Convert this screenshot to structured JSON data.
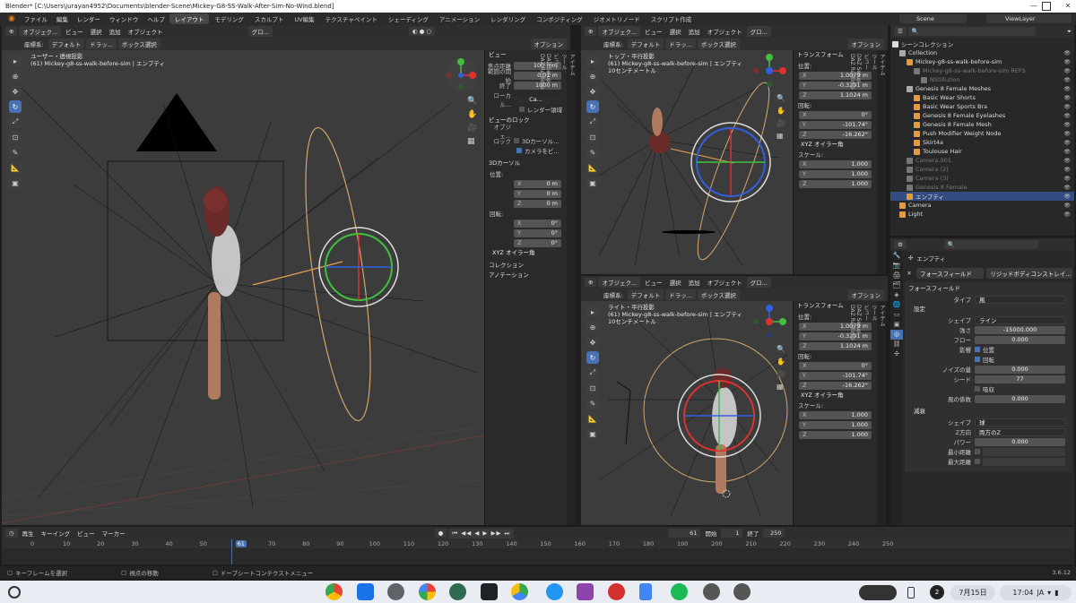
{
  "window": {
    "title": "Blender* [C:\\Users\\jurayan4952\\Documents\\blender-Scene\\Mickey-G8-SS-Walk-After-Sim-No-Wind.blend]"
  },
  "menubar": {
    "menus": [
      "ファイル",
      "編集",
      "レンダー",
      "ウィンドウ",
      "ヘルプ"
    ],
    "workspaces": [
      "レイアウト",
      "モデリング",
      "スカルプト",
      "UV編集",
      "テクスチャペイント",
      "シェーディング",
      "アニメーション",
      "レンダリング",
      "コンポジティング",
      "ジオメトリノード",
      "スクリプト作成"
    ],
    "active_workspace": "レイアウト",
    "scene": "Scene",
    "view_layer": "ViewLayer"
  },
  "viewport_main": {
    "mode": "オブジェク...",
    "menu": [
      "ビュー",
      "選択",
      "追加",
      "オブジェクト"
    ],
    "transform": "グロ...",
    "coord_label": "座標系:",
    "coord_value": "デフォルト",
    "drag": "ドラッ...",
    "select": "ボックス選択",
    "options": "オプション",
    "view_name": "ユーザー・透視投影",
    "object_info": "(61) Mickey-g8-ss-walk-before-sim | エンプティ"
  },
  "view_panel": {
    "title": "ビュー",
    "focal_label": "焦点距離",
    "focal": "100 mm",
    "clip_start_label": "範囲の開始",
    "clip_start": "0.01 m",
    "clip_end_label": "終了",
    "clip_end": "1000 m",
    "local_label": "ローカル...",
    "local_value": "Ca...",
    "render_region": "レンダー領域",
    "lock_title": "ビューのロック",
    "lock_object_label": "オブジェ...",
    "lock_label": "ロック",
    "lock_3d_cursor": "3Dカーソル...",
    "lock_camera": "カメラをビ...",
    "cursor_title": "3Dカーソル",
    "location_label": "位置:",
    "cx": "0 m",
    "cy": "0 m",
    "cz": "0 m",
    "rotation_label": "回転:",
    "rx": "0°",
    "ry": "0°",
    "rz": "0°",
    "euler": "XYZ オイラー角",
    "collection": "コレクション",
    "annotation": "アノテーション"
  },
  "side_tabs": [
    "アイテム",
    "ツール",
    "ビュー",
    "DAZ Setup",
    "DAZ Runtime"
  ],
  "viewport_top": {
    "mode": "オブジェク...",
    "menu": [
      "ビュー",
      "選択",
      "追加",
      "オブジェクト"
    ],
    "transform": "グロ...",
    "coord_label": "座標系:",
    "coord_value": "デフォルト",
    "drag": "ドラッ...",
    "select": "ボックス選択",
    "options": "オプション",
    "view_name": "トップ・平行投影",
    "object_info": "(61) Mickey-g8-ss-walk-before-sim | エンプティ",
    "scale": "10センチメートル"
  },
  "viewport_right": {
    "mode": "オブジェク...",
    "menu": [
      "ビュー",
      "選択",
      "追加",
      "オブジェクト"
    ],
    "transform": "グロ...",
    "coord_label": "座標系:",
    "coord_value": "デフォルト",
    "drag": "ドラッ...",
    "select": "ボックス選択",
    "options": "オプション",
    "view_name": "ライト・平行投影",
    "object_info": "(61) Mickey-g8-ss-walk-before-sim | エンプティ",
    "scale": "10センチメートル"
  },
  "transform_panel": {
    "title": "トランスフォーム",
    "location_label": "位置:",
    "x": "1.0079 m",
    "y": "-0.3291 m",
    "z": "1.1024 m",
    "rotation_label": "回転:",
    "rx": "0°",
    "ry": "-101.74°",
    "rz": "-16.262°",
    "euler": "XYZ オイラー角",
    "scale_label": "スケール:",
    "sx": "1.000",
    "sy": "1.000",
    "sz": "1.000"
  },
  "outliner": {
    "root": "シーンコレクション",
    "items": [
      {
        "label": "Collection",
        "indent": 1,
        "color": "#aaaaaa"
      },
      {
        "label": "Mickey-g8-ss-walk-before-sim",
        "indent": 2,
        "color": "#e69a3c"
      },
      {
        "label": "Mickey-g8-ss-walk-before-sim REFS",
        "indent": 3,
        "color": "#777777",
        "dim": true
      },
      {
        "label": "NStillution",
        "indent": 4,
        "color": "#777777",
        "dim": true
      },
      {
        "label": "Genesis 8 Female Meshes",
        "indent": 2,
        "color": "#aaaaaa"
      },
      {
        "label": "Basic Wear Shorts",
        "indent": 3,
        "color": "#e69a3c"
      },
      {
        "label": "Basic Wear Sports Bra",
        "indent": 3,
        "color": "#e69a3c"
      },
      {
        "label": "Genesis 8 Female Eyelashes",
        "indent": 3,
        "color": "#e69a3c"
      },
      {
        "label": "Genesis 8 Female Mesh",
        "indent": 3,
        "color": "#e69a3c"
      },
      {
        "label": "Push Modifier Weight Node",
        "indent": 3,
        "color": "#e69a3c"
      },
      {
        "label": "Skirt4a",
        "indent": 3,
        "color": "#e69a3c"
      },
      {
        "label": "Toulouse Hair",
        "indent": 3,
        "color": "#e69a3c"
      },
      {
        "label": "Camera.001",
        "indent": 2,
        "color": "#777777",
        "dim": true
      },
      {
        "label": "Camera (2)",
        "indent": 2,
        "color": "#777777",
        "dim": true
      },
      {
        "label": "Camera (3)",
        "indent": 2,
        "color": "#777777",
        "dim": true
      },
      {
        "label": "Genesis 8 Female",
        "indent": 2,
        "color": "#777777",
        "dim": true
      },
      {
        "label": "エンプティ",
        "indent": 2,
        "color": "#e69a3c",
        "selected": true
      },
      {
        "label": "Camera",
        "indent": 1,
        "color": "#e69a3c"
      },
      {
        "label": "Light",
        "indent": 1,
        "color": "#e69a3c"
      }
    ]
  },
  "properties": {
    "object_name": "エンプティ",
    "tab_force": "フォースフィールド",
    "tab_rigid": "リジッドボディコンストレイ...",
    "section": "フォースフィールド",
    "type_label": "タイプ",
    "type_value": "風",
    "settings": "設定",
    "shape_label": "シェイプ",
    "shape_value": "ライン",
    "strength_label": "強さ",
    "strength": "-15000.000",
    "flow_label": "フロー",
    "flow": "0.000",
    "affect_label": "影響",
    "affect_location": "位置",
    "affect_rotation": "回転",
    "noise_label": "ノイズの量",
    "noise": "0.000",
    "seed_label": "シード",
    "seed": "77",
    "absorb": "吸収",
    "wind_factor_label": "風の係数",
    "wind_factor": "0.000",
    "falloff": "減衰",
    "falloff_shape_label": "シェイプ",
    "falloff_shape": "球",
    "z_dir_label": "Z方向",
    "z_dir": "両方のZ",
    "power_label": "パワー",
    "power": "0.000",
    "min_dist_label": "最小距離",
    "max_dist_label": "最大距離"
  },
  "timeline": {
    "menu": [
      "再生",
      "キーイング",
      "ビュー",
      "マーカー"
    ],
    "current_frame": "61",
    "start_label": "開始",
    "start": "1",
    "end_label": "終了",
    "end": "250",
    "ticks": [
      "0",
      "10",
      "20",
      "30",
      "40",
      "50",
      "61",
      "70",
      "80",
      "90",
      "100",
      "110",
      "120",
      "130",
      "140",
      "150",
      "160",
      "170",
      "180",
      "190",
      "200",
      "210",
      "220",
      "230",
      "240",
      "250"
    ]
  },
  "statusbar": {
    "select": "キーフレームを選択",
    "pan": "視点の移動",
    "menu": "ドープシートコンテクストメニュー",
    "version": "3.6.12"
  },
  "taskbar": {
    "date": "7月15日",
    "time": "17:04",
    "lang": "JA",
    "badge": "2"
  }
}
